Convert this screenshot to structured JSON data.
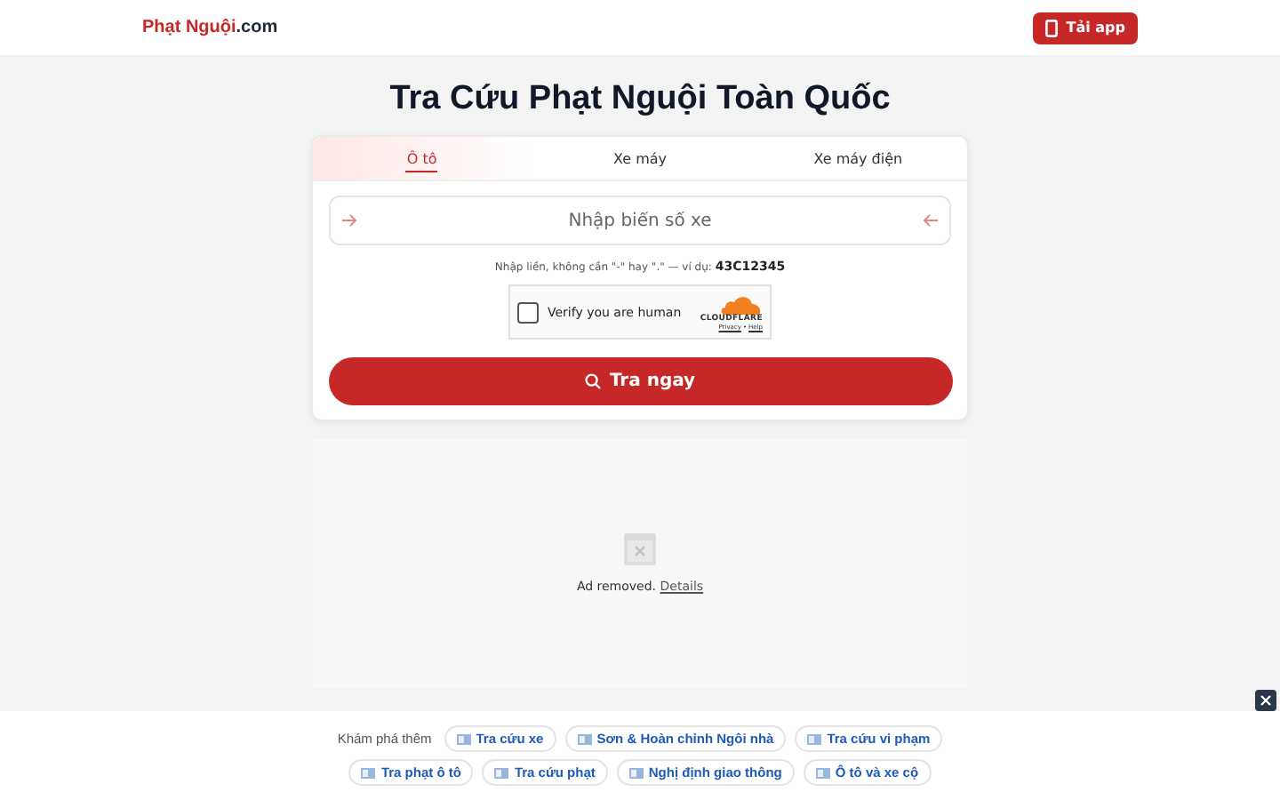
{
  "header": {
    "logo_name": "Phạt Nguội",
    "logo_suffix": ".com",
    "app_button": "Tải app"
  },
  "title": "Tra Cứu Phạt Nguội Toàn Quốc",
  "tabs": [
    {
      "label": "Ô tô",
      "selected": true
    },
    {
      "label": "Xe máy",
      "selected": false
    },
    {
      "label": "Xe máy điện",
      "selected": false
    }
  ],
  "plate_field": {
    "placeholder": "Nhập biển số xe"
  },
  "hint": "Nhập liền, không cần \"-\" hay \".\" — ví dụ: **43C12345**",
  "captcha": {
    "label": "Verify you are human",
    "checked": false,
    "brand": "CLOUDFLARE",
    "privacy": "Privacy",
    "separator": "•",
    "help": "Help"
  },
  "search_button": "Tra ngay",
  "ad": {
    "text": "Ad removed.",
    "link": "Details"
  },
  "explore": {
    "label": "Khám phá thêm",
    "links": [
      {
        "label": "Tra cứu xe"
      },
      {
        "label": "Sơn & Hoàn chỉnh Ngôi nhà"
      },
      {
        "label": "Tra cứu vi phạm"
      },
      {
        "label": "Tra phạt ô tô"
      },
      {
        "label": "Tra cứu phạt"
      },
      {
        "label": "Nghị định giao thông"
      },
      {
        "label": "Ô tô và xe cộ"
      }
    ]
  }
}
